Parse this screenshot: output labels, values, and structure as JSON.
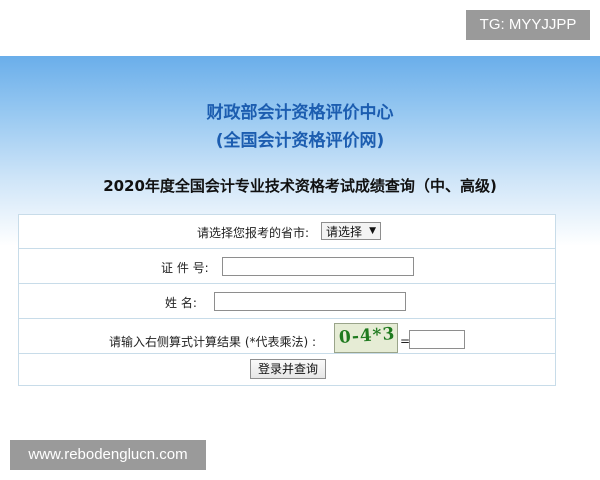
{
  "overlay": {
    "tg_badge": "TG: MYYJJPP",
    "watermark": "www.rebodenglucn.com"
  },
  "header": {
    "org_title": "财政部会计资格评价中心",
    "org_subtitle": "(全国会计资格评价网)",
    "page_title": "2020年度全国会计专业技术资格考试成绩查询（中、高级)"
  },
  "form": {
    "province_label": "请选择您报考的省市:",
    "province_selected": "请选择",
    "id_label": "证 件 号:",
    "id_value": "",
    "name_label": "姓 名:",
    "name_value": "",
    "captcha_label": "请输入右侧算式计算结果 (*代表乘法) :",
    "captcha_image_text": "0-4*3",
    "equals_sign": "=",
    "captcha_answer": "",
    "submit_label": "登录并查询"
  },
  "colors": {
    "title_blue": "#1c5db0",
    "header_gradient_top": "#6aaeea",
    "form_border": "#c8dce9",
    "captcha_green": "#1f7a1f",
    "overlay_gray": "#9a9a9a"
  }
}
